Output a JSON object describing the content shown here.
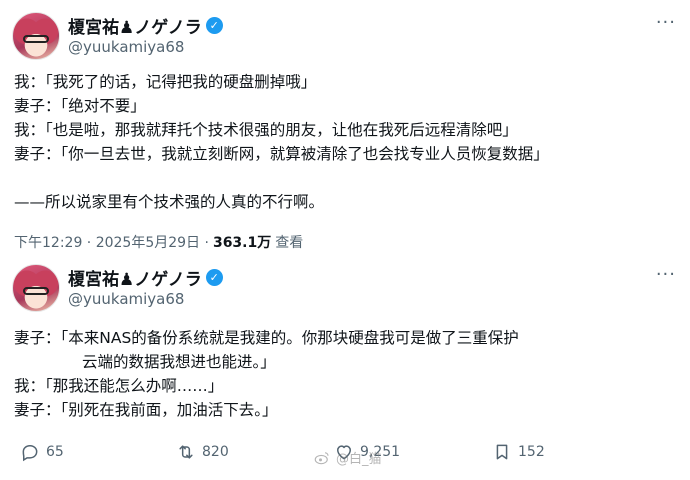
{
  "tweet1": {
    "display_name": "榎宮祐♟ノゲノラ",
    "handle": "@yuukamiya68",
    "lines": [
      "我：「我死了的话，记得把我的硬盘删掉哦」",
      "妻子：「绝对不要」",
      "我：「也是啦，那我就拜托个技术很强的朋友，让他在我死后远程清除吧」",
      "妻子：「你一旦去世，我就立刻断网，就算被清除了也会找专业人员恢复数据」",
      "",
      "——所以说家里有个技术强的人真的不行啊。"
    ],
    "timestamp": "下午12:29 · 2025年5月29日 ·",
    "views": "363.1万",
    "views_label": "查看"
  },
  "tweet2": {
    "display_name": "榎宮祐♟ノゲノラ",
    "handle": "@yuukamiya68",
    "lines": [
      "妻子：「本来NAS的备份系统就是我建的。你那块硬盘我可是做了三重保护",
      "云端的数据我想进也能进。」",
      "我：「那我还能怎么办啊……」",
      "妻子：「别死在我前面，加油活下去。」"
    ],
    "replies": "65",
    "reposts": "820",
    "likes": "9,251",
    "bookmarks": "152",
    "watermark": "@白_猫"
  },
  "colors": {
    "verified": "#1d9bf0",
    "muted": "#536471",
    "text": "#0f1419"
  },
  "icons": [
    "verified-icon",
    "more-icon",
    "reply-icon",
    "repost-icon",
    "like-icon",
    "bookmark-icon",
    "weibo-icon"
  ]
}
